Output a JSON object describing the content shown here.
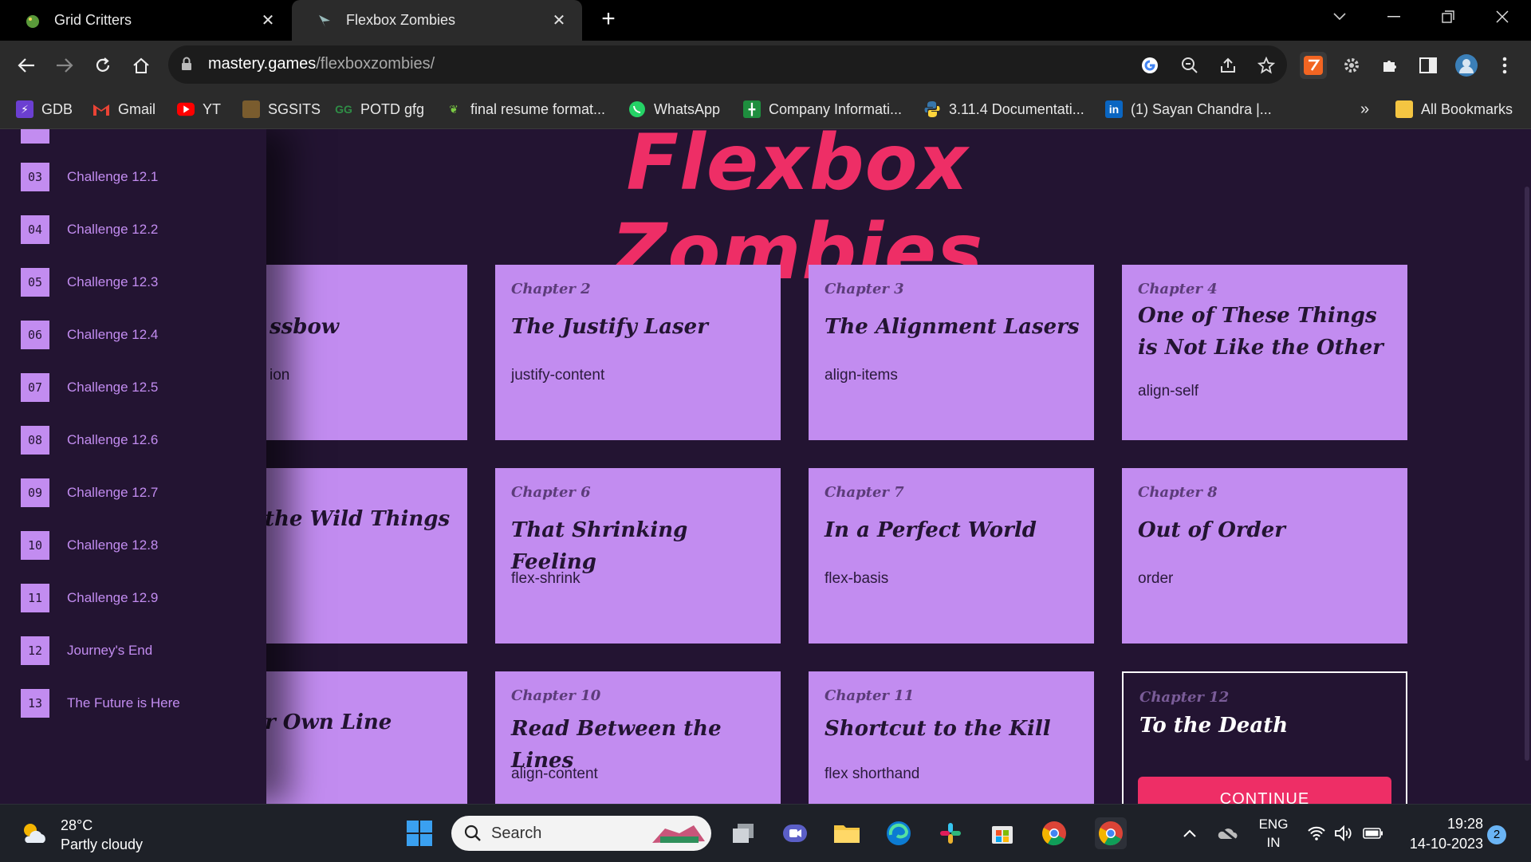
{
  "browser": {
    "tabs": [
      {
        "title": "Grid Critters",
        "active": false
      },
      {
        "title": "Flexbox Zombies",
        "active": true
      }
    ],
    "url": {
      "domain": "mastery.games",
      "path": "/flexboxzombies/"
    },
    "bookmarks": [
      {
        "label": "GDB"
      },
      {
        "label": "Gmail"
      },
      {
        "label": "YT"
      },
      {
        "label": "SGSITS"
      },
      {
        "label": "POTD gfg"
      },
      {
        "label": "final resume format..."
      },
      {
        "label": "WhatsApp"
      },
      {
        "label": "Company Informati..."
      },
      {
        "label": "3.11.4 Documentati..."
      },
      {
        "label": "(1) Sayan Chandra |..."
      }
    ],
    "overflow_label": "»",
    "all_bookmarks": "All Bookmarks"
  },
  "page": {
    "title": "Flexbox Zombies",
    "sidebar": [
      {
        "num": "03",
        "label": "Challenge 12.1"
      },
      {
        "num": "04",
        "label": "Challenge 12.2"
      },
      {
        "num": "05",
        "label": "Challenge 12.3"
      },
      {
        "num": "06",
        "label": "Challenge 12.4"
      },
      {
        "num": "07",
        "label": "Challenge 12.5"
      },
      {
        "num": "08",
        "label": "Challenge 12.6"
      },
      {
        "num": "09",
        "label": "Challenge 12.7"
      },
      {
        "num": "10",
        "label": "Challenge 12.8"
      },
      {
        "num": "11",
        "label": "Challenge 12.9"
      },
      {
        "num": "12",
        "label": "Journey's End"
      },
      {
        "num": "13",
        "label": "The Future is Here"
      }
    ],
    "cards": [
      {
        "chapter": "",
        "title": "ssbow",
        "prop": "ion"
      },
      {
        "chapter": "Chapter 2",
        "title": "The Justify Laser",
        "prop": "justify-content"
      },
      {
        "chapter": "Chapter 3",
        "title": "The Alignment Lasers",
        "prop": "align-items"
      },
      {
        "chapter": "Chapter 4",
        "title": "One of These Things is Not Like the Other",
        "prop": "align-self"
      },
      {
        "chapter": "",
        "title": "the Wild Things",
        "prop": ""
      },
      {
        "chapter": "Chapter 6",
        "title": "That Shrinking Feeling",
        "prop": "flex-shrink"
      },
      {
        "chapter": "Chapter 7",
        "title": "In a Perfect World",
        "prop": "flex-basis"
      },
      {
        "chapter": "Chapter 8",
        "title": "Out of Order",
        "prop": "order"
      },
      {
        "chapter": "",
        "title": "r Own Line",
        "prop": ""
      },
      {
        "chapter": "Chapter 10",
        "title": "Read Between the Lines",
        "prop": "align-content"
      },
      {
        "chapter": "Chapter 11",
        "title": "Shortcut to the Kill",
        "prop": "flex shorthand"
      },
      {
        "chapter": "Chapter 12",
        "title": "To the Death",
        "prop": "",
        "button": "CONTINUE"
      }
    ]
  },
  "taskbar": {
    "weather": {
      "temp": "28°C",
      "condition": "Partly cloudy"
    },
    "search_placeholder": "Search",
    "language": {
      "line1": "ENG",
      "line2": "IN"
    },
    "time": "19:28",
    "date": "14-10-2023",
    "notifications": "2"
  },
  "colors": {
    "accent": "#ee2e66",
    "card": "#c28cf0",
    "background": "#231432"
  }
}
